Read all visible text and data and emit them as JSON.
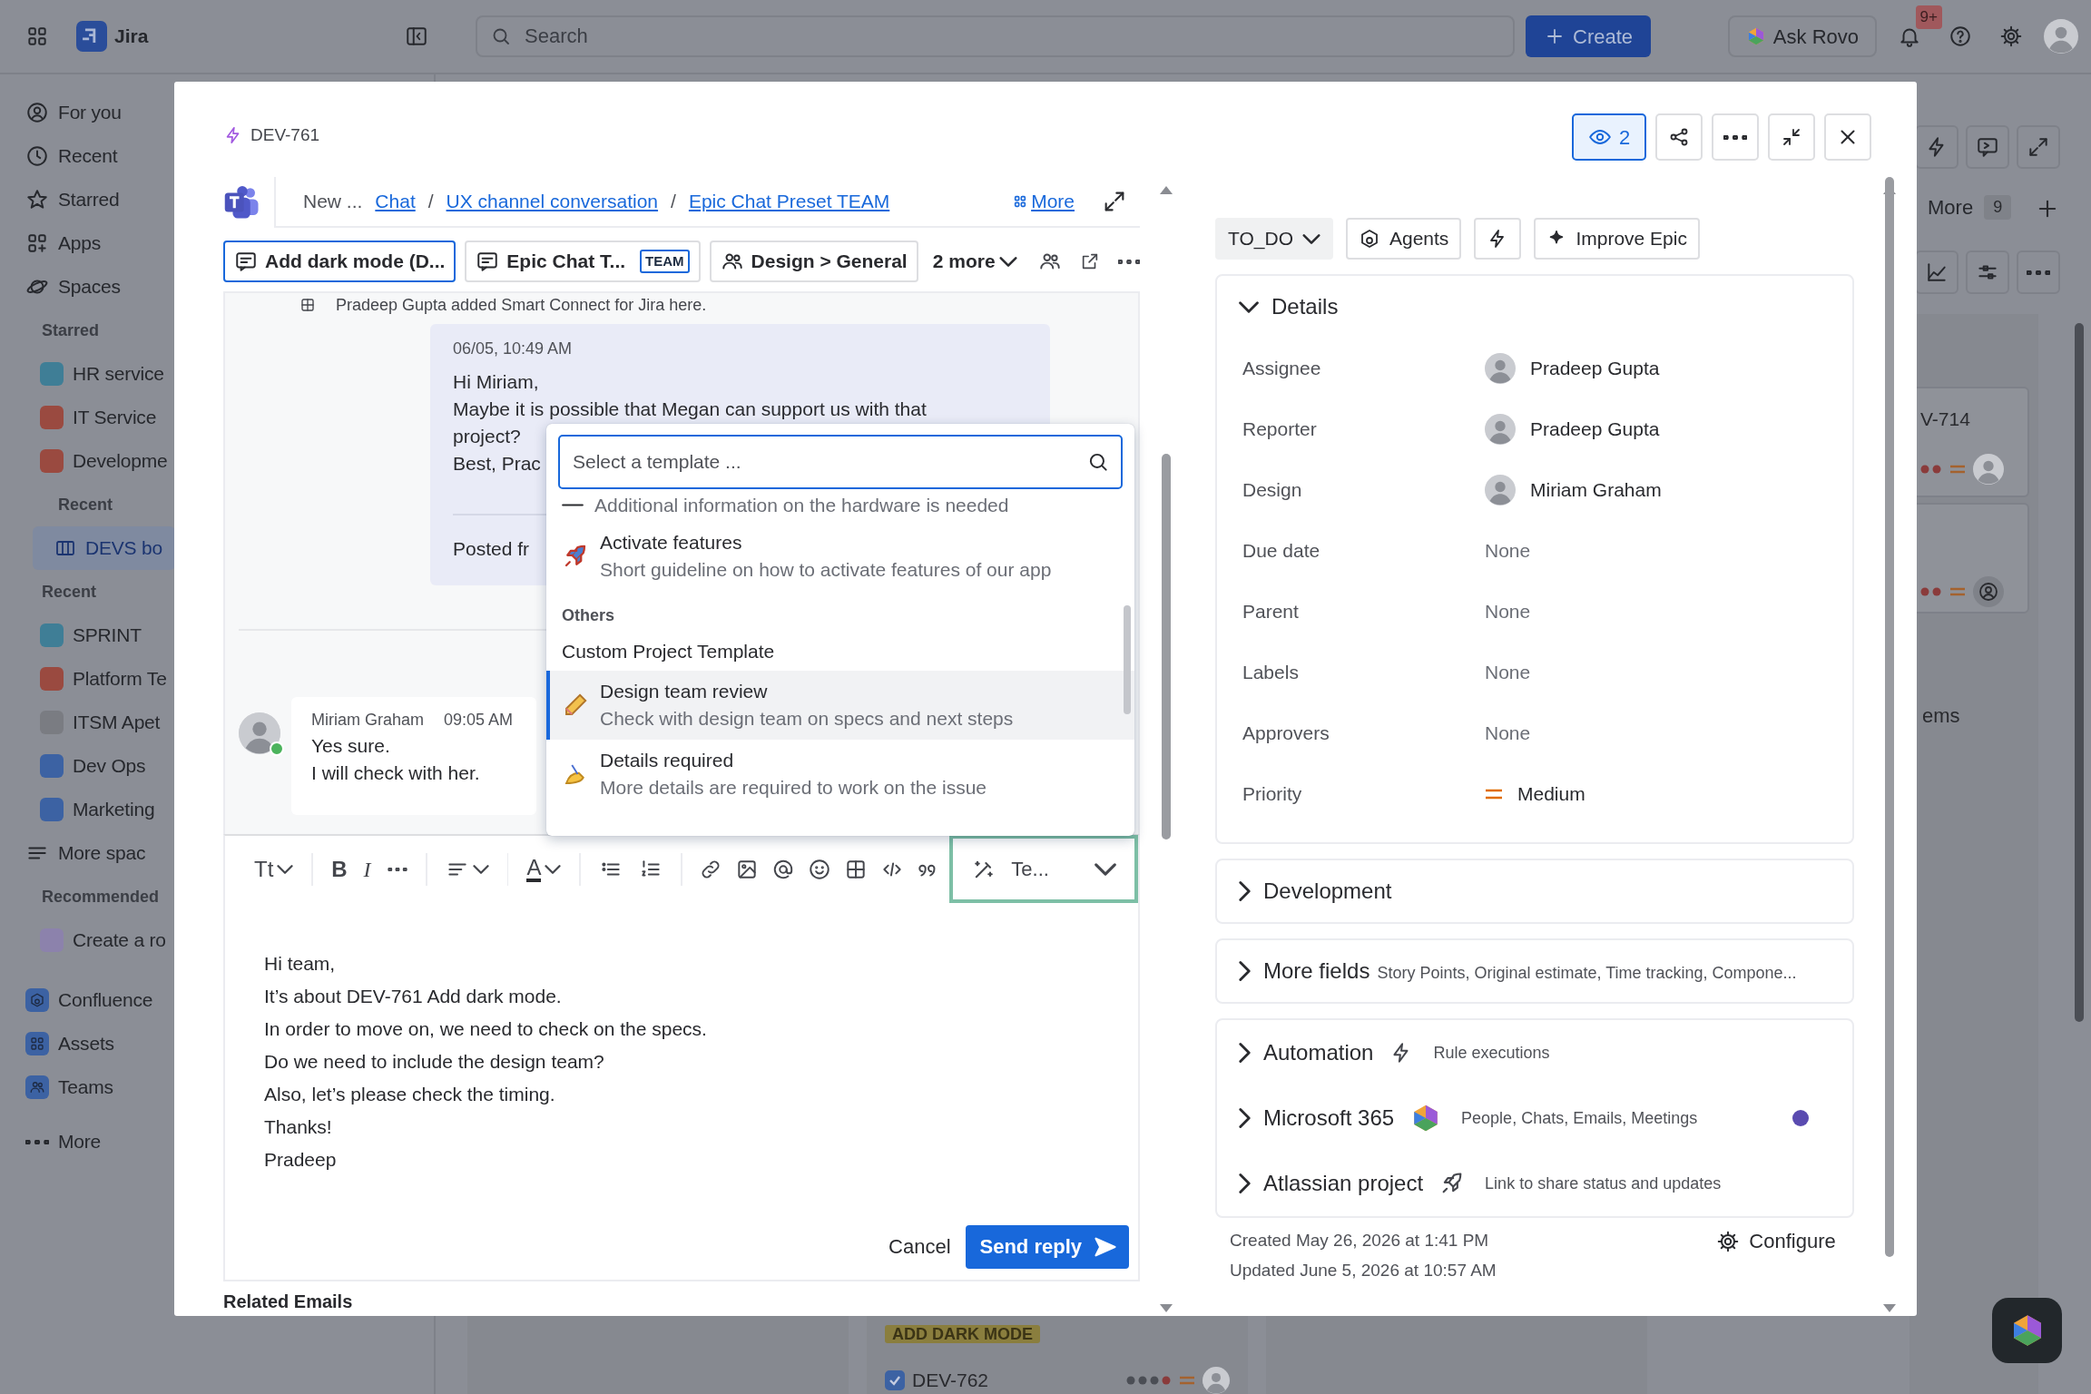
{
  "topbar": {
    "product": "Jira",
    "search": {
      "placeholder": "Search"
    },
    "create": "Create",
    "ask": "Ask Rovo",
    "notification_count": "9+"
  },
  "sidebar": {
    "items": [
      {
        "kind": "nav",
        "label": "For you",
        "selected": false
      },
      {
        "kind": "nav",
        "label": "Recent",
        "selected": false
      },
      {
        "kind": "nav",
        "label": "Starred",
        "selected": false
      },
      {
        "kind": "nav",
        "label": "Apps",
        "selected": false
      },
      {
        "kind": "nav",
        "label": "Spaces",
        "selected": false
      },
      {
        "kind": "header",
        "label": "Starred"
      },
      {
        "kind": "space",
        "label": "HR service",
        "color": "#3f7e96",
        "selected": false
      },
      {
        "kind": "space",
        "label": "IT Service",
        "color": "#9a4a40",
        "selected": false
      },
      {
        "kind": "space",
        "label": "Developme",
        "color": "#9a4a40",
        "selected": false
      },
      {
        "kind": "subheader",
        "label": "Recent"
      },
      {
        "kind": "board",
        "label": "DEVS bo",
        "selected": true
      },
      {
        "kind": "header",
        "label": "Recent"
      },
      {
        "kind": "space",
        "label": "SPRINT",
        "color": "#3f7e96",
        "selected": false
      },
      {
        "kind": "space",
        "label": "Platform Te",
        "color": "#9a4a40",
        "selected": false
      },
      {
        "kind": "space",
        "label": "ITSM Apet",
        "color": "#7a7c82",
        "selected": false
      },
      {
        "kind": "space",
        "label": "Dev Ops",
        "color": "#3c62a3",
        "selected": false
      },
      {
        "kind": "space",
        "label": "Marketing",
        "color": "#3c62a3",
        "selected": false
      },
      {
        "kind": "nav",
        "label": "More spac",
        "selected": false
      },
      {
        "kind": "header",
        "label": "Recommended"
      },
      {
        "kind": "space",
        "label": "Create a ro",
        "color": "#8c82ac",
        "selected": false
      },
      {
        "kind": "app",
        "label": "Confluence",
        "selected": false
      },
      {
        "kind": "app",
        "label": "Assets",
        "selected": false
      },
      {
        "kind": "app",
        "label": "Teams",
        "selected": false
      },
      {
        "kind": "nav",
        "label": "More",
        "selected": false
      }
    ]
  },
  "board": {
    "more": "More",
    "more_count": "9",
    "cards": [
      {
        "key": "V-714",
        "assigned": true
      },
      {
        "assigned": false
      }
    ],
    "column_fragment": "ems",
    "tag": "ADD DARK MODE",
    "bottom_card": {
      "key": "DEV-762",
      "checked": true
    }
  },
  "modal": {
    "issue_key": "DEV-761",
    "watchers": "2",
    "breadcrumb": {
      "lead": "New ...",
      "links": [
        "Chat",
        "UX channel conversation",
        "Epic Chat Preset TEAM"
      ],
      "separators": [
        "/",
        "/"
      ],
      "more": "More"
    },
    "chat_tabs": [
      {
        "kind": "chat",
        "label": "Add dark mode (D...",
        "selected": true
      },
      {
        "kind": "chat",
        "label": "Epic Chat T...",
        "badge": "TEAM",
        "selected": false
      },
      {
        "kind": "channel",
        "label": "Design > General",
        "selected": false
      }
    ],
    "more_tabs": "2 more",
    "system_note": "Pradeep Gupta added Smart Connect for Jira here.",
    "messages": [
      {
        "kind": "outgoing",
        "time": "06/05, 10:49 AM",
        "lines": [
          "Hi Miriam,",
          "Maybe it is possible that Megan can support us with that",
          "project?",
          "Best, Prac"
        ],
        "footer": "Posted fr"
      },
      {
        "kind": "incoming",
        "author": "Miriam Graham",
        "time": "09:05 AM",
        "online": true,
        "lines": [
          "Yes sure.",
          "I will check with her."
        ]
      }
    ],
    "template_menu": {
      "placeholder": "Select a template ...",
      "items": [
        {
          "kind": "fragment",
          "text": "Additional information on the hardware is needed"
        },
        {
          "kind": "template",
          "title": "Activate features",
          "description": "Short guideline on how to activate features of our app",
          "selected": false
        },
        {
          "kind": "group",
          "text": "Others"
        },
        {
          "kind": "plain",
          "title": "Custom Project Template",
          "selected": false
        },
        {
          "kind": "template",
          "title": "Design team review",
          "description": "Check with design team on specs and next steps",
          "selected": true
        },
        {
          "kind": "template",
          "title": "Details required",
          "description": "More details are required to work on the issue",
          "selected": false
        }
      ]
    },
    "toolbar": {
      "text_style": "Tt",
      "bold": "B",
      "italic": "I",
      "text_color": "A",
      "template_button": {
        "label": "Te...",
        "highlighted": true
      }
    },
    "reply_lines": [
      "Hi team,",
      "It’s about DEV-761 Add dark mode.",
      "In order to move on, we need to check on the specs.",
      "Do we need to include the design team?",
      "Also, let’s please check the timing.",
      "Thanks!",
      "Pradeep"
    ],
    "cancel": "Cancel",
    "send": "Send reply",
    "related": "Related Emails"
  },
  "details_panel": {
    "status": "TO_DO",
    "actions": [
      "Agents",
      "Improve Epic"
    ],
    "details": {
      "title": "Details",
      "expanded": true,
      "fields": [
        {
          "label": "Assignee",
          "kind": "person",
          "value": "Pradeep Gupta"
        },
        {
          "label": "Reporter",
          "kind": "person",
          "value": "Pradeep Gupta"
        },
        {
          "label": "Design",
          "kind": "person",
          "value": "Miriam Graham"
        },
        {
          "label": "Due date",
          "kind": "empty",
          "value": "None"
        },
        {
          "label": "Parent",
          "kind": "empty",
          "value": "None"
        },
        {
          "label": "Labels",
          "kind": "empty",
          "value": "None"
        },
        {
          "label": "Approvers",
          "kind": "empty",
          "value": "None"
        },
        {
          "label": "Priority",
          "kind": "priority",
          "value": "Medium"
        }
      ]
    },
    "sections": [
      {
        "title": "Development",
        "expanded": false
      },
      {
        "title": "More fields",
        "summary": "Story Points, Original estimate, Time tracking, Compone...",
        "expanded": false
      }
    ],
    "integrations": [
      {
        "kind": "automation",
        "title": "Automation",
        "summary": "Rule executions",
        "expanded": false,
        "connected": false
      },
      {
        "kind": "m365",
        "title": "Microsoft 365",
        "summary": "People, Chats, Emails, Meetings",
        "expanded": false,
        "connected": true
      },
      {
        "kind": "project",
        "title": "Atlassian project",
        "summary": "Link to share status and updates",
        "expanded": false,
        "connected": false
      }
    ],
    "created": "Created May 26, 2026 at 1:41 PM",
    "updated": "Updated June 5, 2026 at 10:57 AM",
    "configure": "Configure"
  }
}
